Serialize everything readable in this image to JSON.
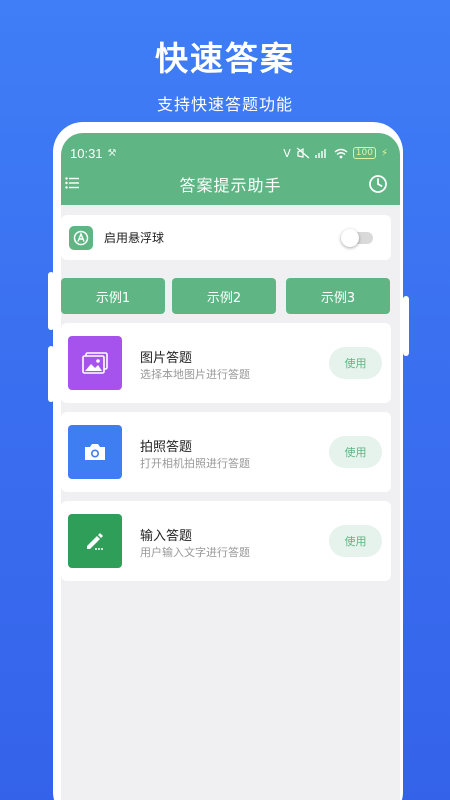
{
  "hero": {
    "title": "快速答案",
    "subtitle": "支持快速答题功能"
  },
  "status_bar": {
    "time": "10:31",
    "battery": "100"
  },
  "app_bar": {
    "title": "答案提示助手"
  },
  "float_ball": {
    "label": "启用悬浮球",
    "enabled": false
  },
  "examples": [
    "示例1",
    "示例2",
    "示例3"
  ],
  "features": [
    {
      "title": "图片答题",
      "desc": "选择本地图片进行答题",
      "action": "使用",
      "color": "#a653ee",
      "icon": "image-icon"
    },
    {
      "title": "拍照答题",
      "desc": "打开相机拍照进行答题",
      "action": "使用",
      "color": "#3f7ef2",
      "icon": "camera-icon"
    },
    {
      "title": "输入答题",
      "desc": "用户输入文字进行答题",
      "action": "使用",
      "color": "#2e9e59",
      "icon": "pencil-icon"
    }
  ],
  "colors": {
    "primary_green": "#5fb684",
    "background_blue": "#3a6ef0"
  }
}
